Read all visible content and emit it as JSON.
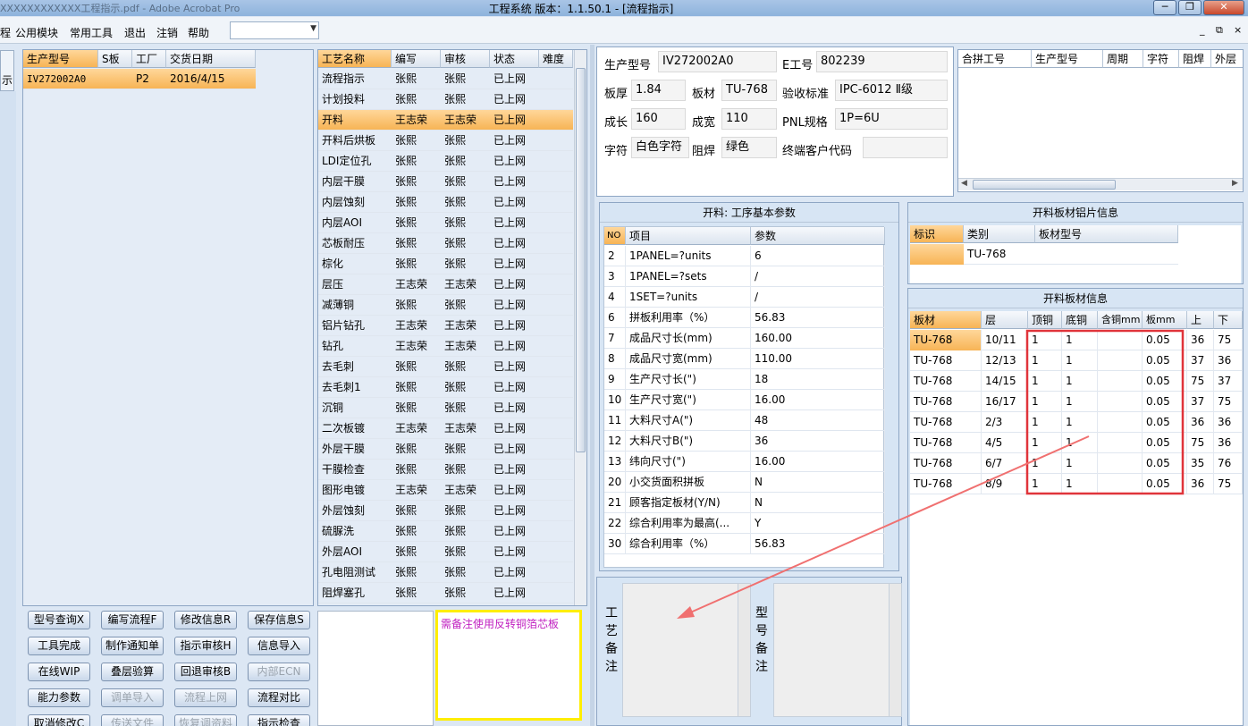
{
  "window": {
    "title": "工程系统   版本：1.1.50.1 - [流程指示]",
    "background_doc": "XXXXXXXXXXXX工程指示.pdf - Adobe Acrobat Pro",
    "buttons": [
      "─",
      "❐",
      "✕"
    ]
  },
  "menu": {
    "items": [
      "程",
      "公用模块",
      "常用工具",
      "退出",
      "注销",
      "帮助"
    ],
    "combo_value": "",
    "mdi_buttons": [
      "_",
      "⧉",
      "×"
    ]
  },
  "left_strip": {
    "label": "示"
  },
  "order_grid": {
    "headers": [
      "生产型号",
      "S板",
      "工厂",
      "交货日期"
    ],
    "rows": [
      {
        "model": "IV272002A0",
        "s": "",
        "factory": "P2",
        "date": "2016/4/15"
      }
    ]
  },
  "process_grid": {
    "headers": [
      "工艺名称",
      "编写",
      "审核",
      "状态",
      "难度"
    ],
    "rows": [
      {
        "name": "流程指示",
        "writer": "张熙",
        "reviewer": "张熙",
        "status": "已上网",
        "diff": ""
      },
      {
        "name": "计划投料",
        "writer": "张熙",
        "reviewer": "张熙",
        "status": "已上网",
        "diff": ""
      },
      {
        "name": "开料",
        "writer": "王志荣",
        "reviewer": "王志荣",
        "status": "已上网",
        "diff": ""
      },
      {
        "name": "开料后烘板",
        "writer": "张熙",
        "reviewer": "张熙",
        "status": "已上网",
        "diff": ""
      },
      {
        "name": "LDI定位孔",
        "writer": "张熙",
        "reviewer": "张熙",
        "status": "已上网",
        "diff": ""
      },
      {
        "name": "内层干膜",
        "writer": "张熙",
        "reviewer": "张熙",
        "status": "已上网",
        "diff": ""
      },
      {
        "name": "内层蚀刻",
        "writer": "张熙",
        "reviewer": "张熙",
        "status": "已上网",
        "diff": ""
      },
      {
        "name": "内层AOI",
        "writer": "张熙",
        "reviewer": "张熙",
        "status": "已上网",
        "diff": ""
      },
      {
        "name": "芯板耐压",
        "writer": "张熙",
        "reviewer": "张熙",
        "status": "已上网",
        "diff": ""
      },
      {
        "name": "棕化",
        "writer": "张熙",
        "reviewer": "张熙",
        "status": "已上网",
        "diff": ""
      },
      {
        "name": "层压",
        "writer": "王志荣",
        "reviewer": "王志荣",
        "status": "已上网",
        "diff": ""
      },
      {
        "name": "减薄铜",
        "writer": "张熙",
        "reviewer": "张熙",
        "status": "已上网",
        "diff": ""
      },
      {
        "name": "铝片钻孔",
        "writer": "王志荣",
        "reviewer": "王志荣",
        "status": "已上网",
        "diff": ""
      },
      {
        "name": "钻孔",
        "writer": "王志荣",
        "reviewer": "王志荣",
        "status": "已上网",
        "diff": ""
      },
      {
        "name": "去毛刺",
        "writer": "张熙",
        "reviewer": "张熙",
        "status": "已上网",
        "diff": ""
      },
      {
        "name": "去毛刺1",
        "writer": "张熙",
        "reviewer": "张熙",
        "status": "已上网",
        "diff": ""
      },
      {
        "name": "沉铜",
        "writer": "张熙",
        "reviewer": "张熙",
        "status": "已上网",
        "diff": ""
      },
      {
        "name": "二次板镀",
        "writer": "王志荣",
        "reviewer": "王志荣",
        "status": "已上网",
        "diff": ""
      },
      {
        "name": "外层干膜",
        "writer": "张熙",
        "reviewer": "张熙",
        "status": "已上网",
        "diff": ""
      },
      {
        "name": "干膜检查",
        "writer": "张熙",
        "reviewer": "张熙",
        "status": "已上网",
        "diff": ""
      },
      {
        "name": "图形电镀",
        "writer": "王志荣",
        "reviewer": "王志荣",
        "status": "已上网",
        "diff": ""
      },
      {
        "name": "外层蚀刻",
        "writer": "张熙",
        "reviewer": "张熙",
        "status": "已上网",
        "diff": ""
      },
      {
        "name": "硫脲洗",
        "writer": "张熙",
        "reviewer": "张熙",
        "status": "已上网",
        "diff": ""
      },
      {
        "name": "外层AOI",
        "writer": "张熙",
        "reviewer": "张熙",
        "status": "已上网",
        "diff": ""
      },
      {
        "name": "孔电阻测试",
        "writer": "张熙",
        "reviewer": "张熙",
        "status": "已上网",
        "diff": ""
      },
      {
        "name": "阻焊塞孔",
        "writer": "张熙",
        "reviewer": "张熙",
        "status": "已上网",
        "diff": ""
      }
    ]
  },
  "buttons": [
    [
      "型号查询X",
      "编写流程F",
      "修改信息R",
      "保存信息S"
    ],
    [
      "工具完成",
      "制作通知单",
      "指示审核H",
      "信息导入"
    ],
    [
      "在线WIP",
      "叠层验算",
      "回退审核B",
      "内部ECN"
    ],
    [
      "能力参数",
      "调单导入",
      "流程上网",
      "流程对比"
    ],
    [
      "取消修改C",
      "传送文件",
      "恢复调资料",
      "指示检查"
    ]
  ],
  "note": {
    "text": "需备注使用反转铜箔芯板"
  },
  "info": {
    "model_label": "生产型号",
    "model": "IV272002A0",
    "eno_label": "E工号",
    "eno": "802239",
    "thick_label": "板厚",
    "thick": "1.84",
    "material_label": "板材",
    "material": "TU-768",
    "std_label": "验收标准",
    "std": "IPC-6012 Ⅱ级",
    "len_label": "成长",
    "len": "160",
    "wid_label": "成宽",
    "wid": "110",
    "pnl_label": "PNL规格",
    "pnl": "1P=6U",
    "char_label": "字符",
    "char": "白色字符",
    "mask_label": "阻焊",
    "mask": "绿色",
    "cust_label": "终端客户代码",
    "cust": ""
  },
  "merge_grid": {
    "headers": [
      "合拼工号",
      "生产型号",
      "周期",
      "字符",
      "阻焊",
      "外层"
    ]
  },
  "params": {
    "title": "开料: 工序基本参数",
    "headers": [
      "NO",
      "项目",
      "参数"
    ],
    "rows": [
      {
        "no": "2",
        "item": "1PANEL=?units",
        "val": "6"
      },
      {
        "no": "3",
        "item": "1PANEL=?sets",
        "val": "/"
      },
      {
        "no": "4",
        "item": "1SET=?units",
        "val": "/"
      },
      {
        "no": "6",
        "item": "拼板利用率（%）",
        "val": "56.83"
      },
      {
        "no": "7",
        "item": "成品尺寸长(mm)",
        "val": "160.00"
      },
      {
        "no": "8",
        "item": "成品尺寸宽(mm)",
        "val": "110.00"
      },
      {
        "no": "9",
        "item": "生产尺寸长(\")",
        "val": "18"
      },
      {
        "no": "10",
        "item": "生产尺寸宽(\")",
        "val": "16.00"
      },
      {
        "no": "11",
        "item": "大料尺寸A(\")",
        "val": "48"
      },
      {
        "no": "12",
        "item": "大料尺寸B(\")",
        "val": "36"
      },
      {
        "no": "13",
        "item": "纬向尺寸(\")",
        "val": "16.00"
      },
      {
        "no": "20",
        "item": "小交货面积拼板",
        "val": "N"
      },
      {
        "no": "21",
        "item": "顾客指定板材(Y/N)",
        "val": "N"
      },
      {
        "no": "22",
        "item": "综合利用率为最高(...",
        "val": "Y"
      },
      {
        "no": "30",
        "item": "综合利用率（%）",
        "val": "56.83"
      }
    ]
  },
  "alu": {
    "title": "开料板材铝片信息",
    "headers": [
      "标识",
      "类别",
      "板材型号"
    ],
    "rows": [
      {
        "tag": "",
        "type": "TU-768",
        "model": ""
      }
    ]
  },
  "sheet": {
    "title": "开料板材信息",
    "headers": [
      "板材",
      "层",
      "顶铜",
      "底铜",
      "含铜mm",
      "板mm",
      "上",
      "下"
    ],
    "rows": [
      {
        "mat": "TU-768",
        "layer": "10/11",
        "top": "1",
        "bot": "1",
        "cu": "",
        "board": "0.05",
        "up": "36",
        "down": "75"
      },
      {
        "mat": "TU-768",
        "layer": "12/13",
        "top": "1",
        "bot": "1",
        "cu": "",
        "board": "0.05",
        "up": "37",
        "down": "36"
      },
      {
        "mat": "TU-768",
        "layer": "14/15",
        "top": "1",
        "bot": "1",
        "cu": "",
        "board": "0.05",
        "up": "75",
        "down": "37"
      },
      {
        "mat": "TU-768",
        "layer": "16/17",
        "top": "1",
        "bot": "1",
        "cu": "",
        "board": "0.05",
        "up": "37",
        "down": "75"
      },
      {
        "mat": "TU-768",
        "layer": "2/3",
        "top": "1",
        "bot": "1",
        "cu": "",
        "board": "0.05",
        "up": "36",
        "down": "36"
      },
      {
        "mat": "TU-768",
        "layer": "4/5",
        "top": "1",
        "bot": "1",
        "cu": "",
        "board": "0.05",
        "up": "75",
        "down": "36"
      },
      {
        "mat": "TU-768",
        "layer": "6/7",
        "top": "1",
        "bot": "1",
        "cu": "",
        "board": "0.05",
        "up": "35",
        "down": "76"
      },
      {
        "mat": "TU-768",
        "layer": "8/9",
        "top": "1",
        "bot": "1",
        "cu": "",
        "board": "0.05",
        "up": "36",
        "down": "75"
      }
    ]
  },
  "remarks": {
    "process_label": "工艺备注",
    "model_label": "型号备注"
  },
  "colors": {
    "highlight": "#f7b455",
    "annotation_red": "#e0343a",
    "note_border": "#ffee00",
    "note_text": "#c020c0"
  }
}
